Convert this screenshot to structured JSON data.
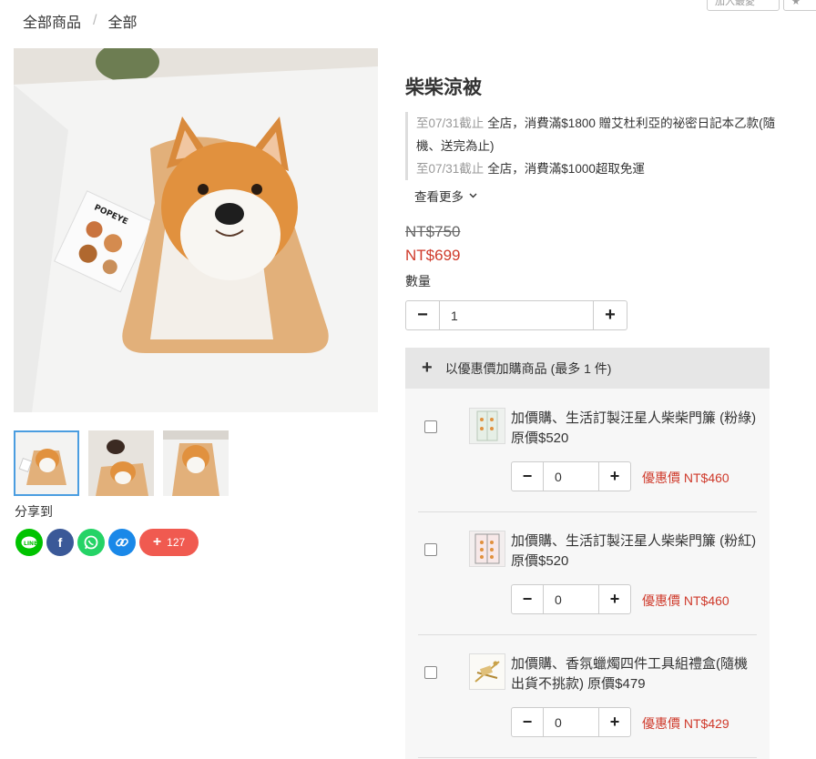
{
  "top_buttons": [
    "加入最愛",
    "分享"
  ],
  "breadcrumb": [
    "全部商品",
    "全部"
  ],
  "product": {
    "title": "柴柴涼被",
    "promotions": [
      {
        "date": "至07/31截止",
        "text": "全店，消費滿$1800 贈艾杜利亞的祕密日記本乙款(隨機、送完為止)"
      },
      {
        "date": "至07/31截止",
        "text": "全店，消費滿$1000超取免運"
      }
    ],
    "see_more": "查看更多",
    "original_price": "NT$750",
    "sale_price": "NT$699",
    "qty_label": "數量",
    "qty_value": "1"
  },
  "share": {
    "label": "分享到",
    "count": "127",
    "icons": [
      "line-icon",
      "facebook-icon",
      "whatsapp-icon",
      "link-icon"
    ]
  },
  "addon": {
    "header": "以優惠價加購商品 (最多 1 件)",
    "items": [
      {
        "name": "加價購、生活訂製汪星人柴柴門簾 (粉綠) 原價$520",
        "qty": "0",
        "deal": "優惠價 NT$460"
      },
      {
        "name": "加價購、生活訂製汪星人柴柴門簾 (粉紅) 原價$520",
        "qty": "0",
        "deal": "優惠價 NT$460"
      },
      {
        "name": "加價購、香氛蠟燭四件工具組禮盒(隨機出貨不挑款) 原價$479",
        "qty": "0",
        "deal": "優惠價 NT$429"
      }
    ]
  },
  "colors": {
    "accent_red": "#cf3a2b",
    "thumb_border": "#4a9de0"
  }
}
